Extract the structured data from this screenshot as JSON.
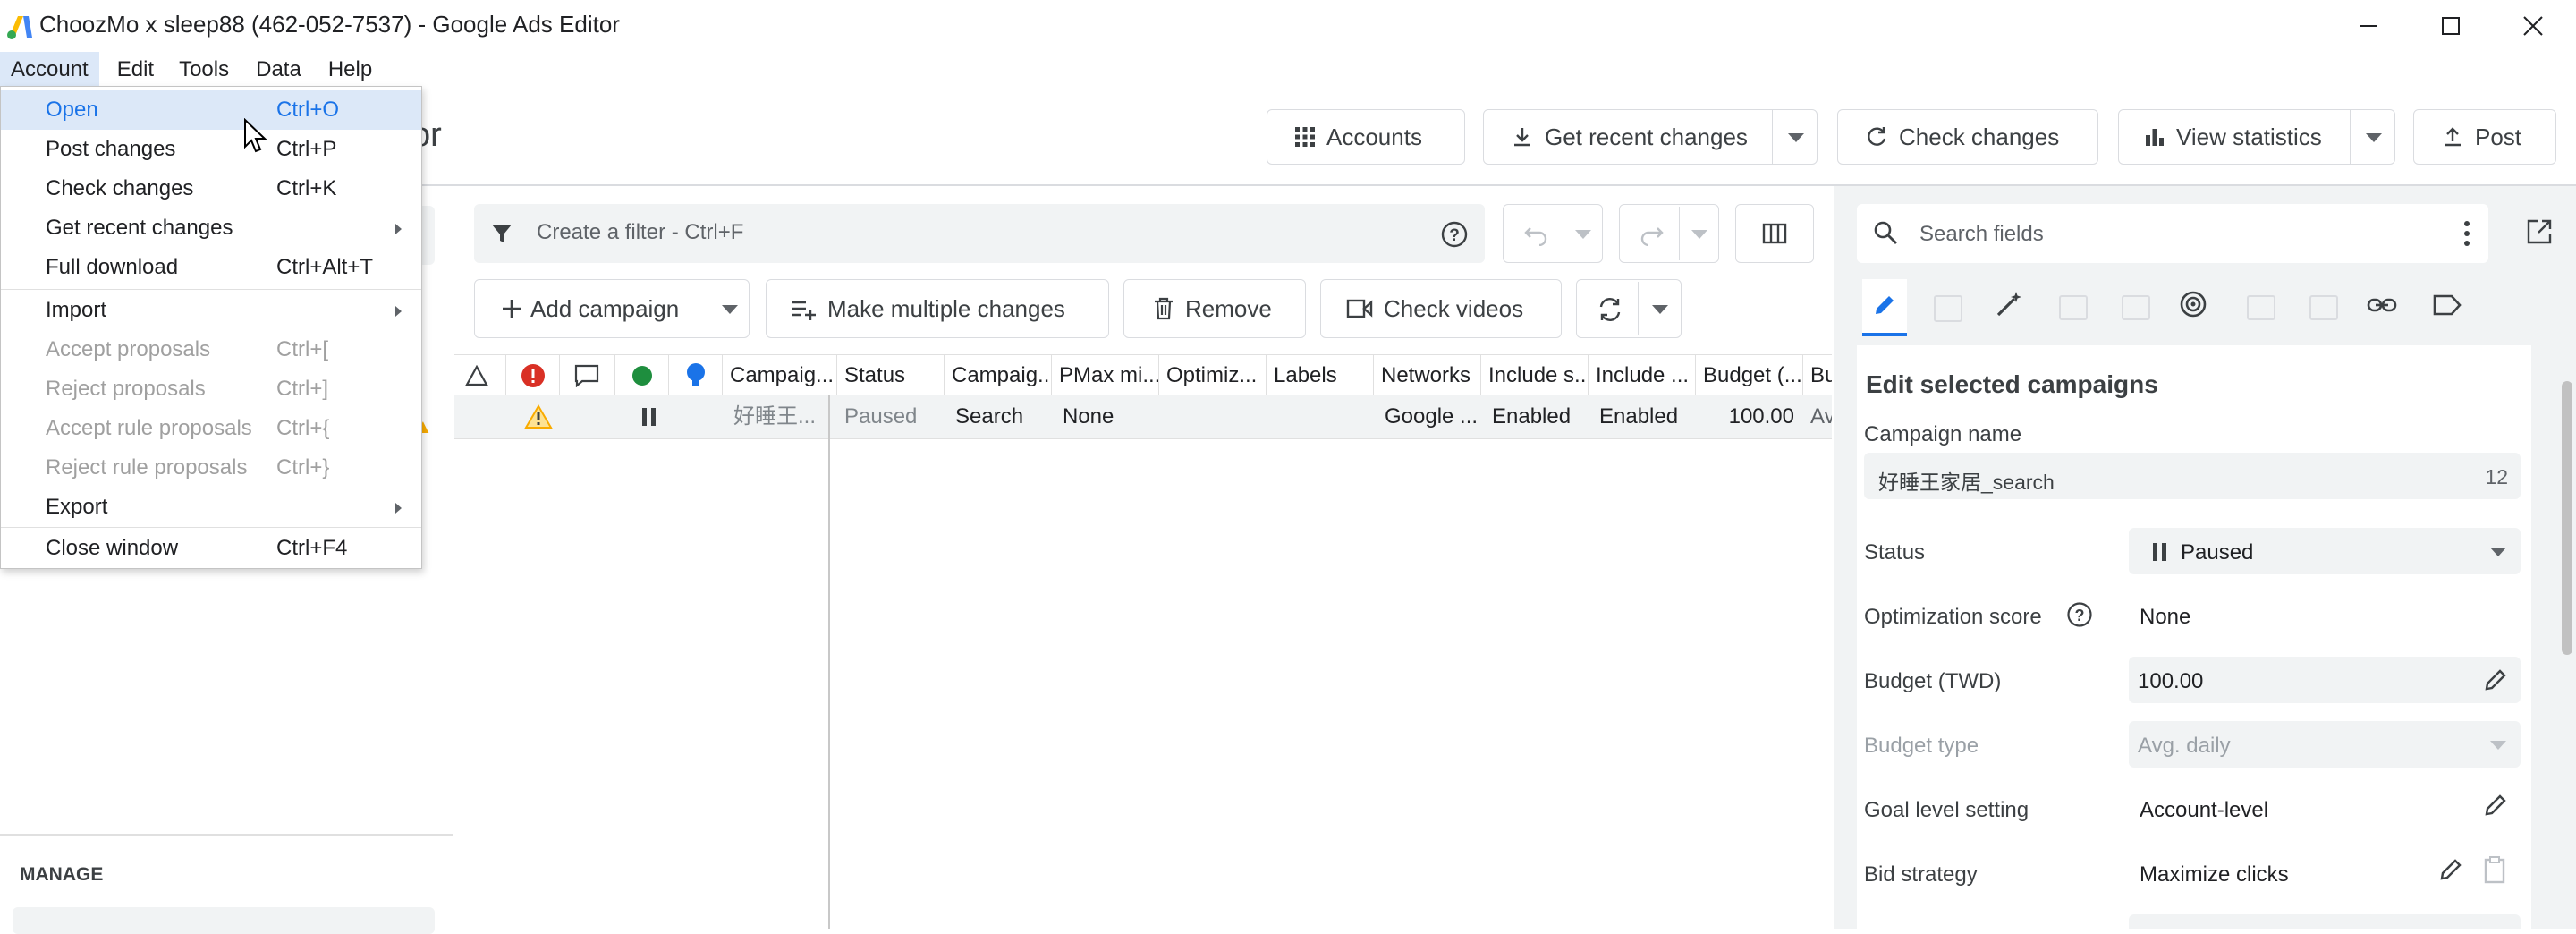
{
  "window": {
    "title": "ChoozMo x sleep88 (462-052-7537) - Google Ads Editor",
    "partial_app_title": "or"
  },
  "menubar": [
    "Account",
    "Edit",
    "Tools",
    "Data",
    "Help"
  ],
  "account_menu": {
    "items": [
      {
        "label": "Open",
        "shortcut": "Ctrl+O"
      },
      {
        "label": "Post changes",
        "shortcut": "Ctrl+P"
      },
      {
        "label": "Check changes",
        "shortcut": "Ctrl+K"
      },
      {
        "label": "Get recent changes",
        "shortcut": ""
      },
      {
        "label": "Full download",
        "shortcut": "Ctrl+Alt+T"
      },
      {
        "label": "Import",
        "shortcut": ""
      },
      {
        "label": "Accept proposals",
        "shortcut": "Ctrl+["
      },
      {
        "label": "Reject proposals",
        "shortcut": "Ctrl+]"
      },
      {
        "label": "Accept rule proposals",
        "shortcut": "Ctrl+{"
      },
      {
        "label": "Reject rule proposals",
        "shortcut": "Ctrl+}"
      },
      {
        "label": "Export",
        "shortcut": ""
      },
      {
        "label": "Close window",
        "shortcut": "Ctrl+F4"
      }
    ]
  },
  "toolbar": {
    "accounts": "Accounts",
    "get_recent_changes": "Get recent changes",
    "check_changes": "Check changes",
    "view_statistics": "View statistics",
    "post": "Post"
  },
  "filter": {
    "placeholder": "Create a filter - Ctrl+F"
  },
  "actions": {
    "add_campaign": "Add campaign",
    "make_multiple_changes": "Make multiple changes",
    "remove": "Remove",
    "check_videos": "Check videos"
  },
  "grid": {
    "columns": [
      "Campaig...",
      "Status",
      "Campaig...",
      "PMax mi...",
      "Optimiz...",
      "Labels",
      "Networks",
      "Include s...",
      "Include ...",
      "Budget (...",
      "Bud"
    ],
    "row": {
      "campaign": "好睡王...",
      "status": "Paused",
      "campaign_type": "Search",
      "pmax": "None",
      "optimization": "",
      "labels": "",
      "networks": "Google ...",
      "include_search": "Enabled",
      "include_display": "Enabled",
      "budget": "100.00",
      "budget_type": "Av"
    }
  },
  "left": {
    "manage_label": "MANAGE"
  },
  "right": {
    "search_placeholder": "Search fields",
    "heading": "Edit selected campaigns",
    "campaign_name_label": "Campaign name",
    "campaign_name": "好睡王家居_search",
    "campaign_name_count": "12",
    "status_label": "Status",
    "status_value": "Paused",
    "opt_label": "Optimization score",
    "opt_value": "None",
    "budget_label": "Budget (TWD)",
    "budget_value": "100.00",
    "budget_type_label": "Budget type",
    "budget_type_value": "Avg. daily",
    "goal_label": "Goal level setting",
    "goal_value": "Account-level",
    "bid_label": "Bid strategy",
    "bid_value": "Maximize clicks"
  },
  "colors": {
    "accent": "#1a73e8",
    "error": "#d93025",
    "success": "#1e8e3e",
    "warning": "#f9ab00",
    "menu_highlight": "#dce8f8"
  }
}
